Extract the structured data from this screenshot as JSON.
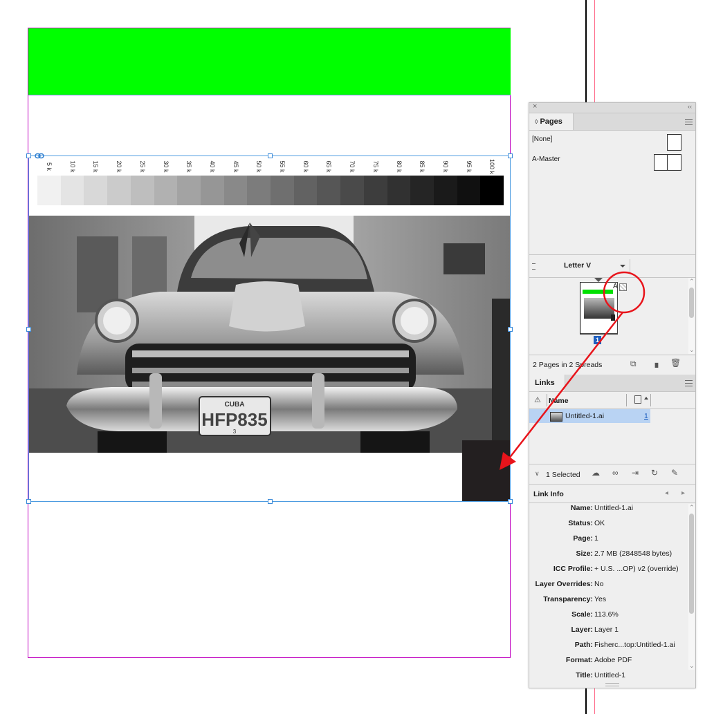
{
  "gray_ramp": {
    "labels": [
      "5 k",
      "10 k",
      "15 k",
      "20 k",
      "25 k",
      "30 k",
      "35 k",
      "40 k",
      "45 k",
      "50 k",
      "55 k",
      "60 k",
      "65 k",
      "70 k",
      "75 k",
      "80 k",
      "85 k",
      "90 k",
      "95 k",
      "100 k"
    ],
    "swatches": [
      "#f1f1f1",
      "#e4e4e4",
      "#d8d8d8",
      "#cbcbcb",
      "#bebebe",
      "#b1b1b1",
      "#a3a3a3",
      "#969696",
      "#898989",
      "#7c7c7c",
      "#6f6f6f",
      "#626262",
      "#565656",
      "#4a4a4a",
      "#3d3d3d",
      "#313131",
      "#252525",
      "#1a1a1a",
      "#101010",
      "#000000"
    ]
  },
  "photo": {
    "plate_top": "CUBA",
    "plate_text": "HFP835",
    "plate_sub": "3"
  },
  "pages_panel": {
    "close_glyph": "×",
    "collapse_glyph": "‹‹",
    "tab_label": "Pages",
    "tab_glyph": "◊",
    "masters": [
      "[None]",
      "A-Master"
    ],
    "page_size": "Letter V",
    "page_master_letter": "A",
    "page_number": "1",
    "status": "2 Pages in 2 Spreads"
  },
  "links_panel": {
    "tab_label": "Links",
    "col_name": "Name",
    "file_name": "Untitled-1.ai",
    "file_page": "1",
    "selected_text": "1 Selected",
    "link_info_title": "Link Info",
    "info": [
      {
        "k": "Name:",
        "v": "Untitled-1.ai"
      },
      {
        "k": "Status:",
        "v": "OK"
      },
      {
        "k": "Page:",
        "v": "1"
      },
      {
        "k": "Size:",
        "v": "2.7 MB (2848548 bytes)"
      },
      {
        "k": "ICC Profile:",
        "v": "+ U.S. ...OP) v2 (override)"
      },
      {
        "k": "Layer Overrides:",
        "v": "No"
      },
      {
        "k": "Transparency:",
        "v": "Yes"
      },
      {
        "k": "Scale:",
        "v": "113.6%"
      },
      {
        "k": "Layer:",
        "v": "Layer 1"
      },
      {
        "k": "Path:",
        "v": "Fisherc...top:Untitled-1.ai"
      },
      {
        "k": "Format:",
        "v": "Adobe PDF"
      },
      {
        "k": "Title:",
        "v": "Untitled-1"
      }
    ]
  },
  "colors": {
    "annotation": "#e8141b",
    "frame": "#4a9ae0",
    "page_border": "#c000c0",
    "green": "#00ff00"
  }
}
